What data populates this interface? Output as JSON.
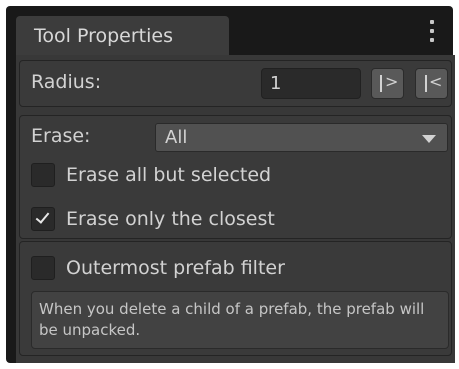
{
  "window": {
    "tab_title": "Tool Properties",
    "menu_icon": "kebab-menu-icon"
  },
  "radius": {
    "label": "Radius:",
    "value": "1",
    "increase_button": "|>",
    "decrease_button": "|<"
  },
  "erase": {
    "label": "Erase:",
    "selected_option": "All",
    "options": [
      {
        "label": "Erase all but selected",
        "checked": false
      },
      {
        "label": "Erase only the closest",
        "checked": true
      }
    ]
  },
  "prefab": {
    "filter_label": "Outermost prefab filter",
    "filter_checked": false,
    "help_text": "When you delete a child of a prefab, the prefab will be unpacked."
  }
}
